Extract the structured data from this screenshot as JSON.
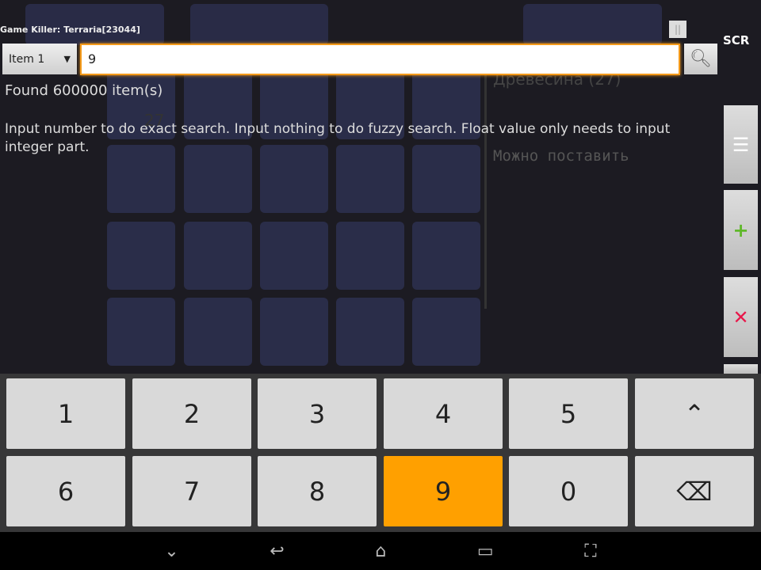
{
  "header": {
    "title": "Game Killer: Terraria[23044]",
    "pause_icon": "pause-icon",
    "scr_label": "SCR"
  },
  "search": {
    "item_select": "Item 1",
    "value": "9",
    "search_icon": "search-icon"
  },
  "status": {
    "found": "Found 600000 item(s)",
    "hint": "Input number to do exact search. Input nothing to do fuzzy search. Float value only needs to input integer part."
  },
  "game": {
    "item_name": "Древесина (27)",
    "item_desc": "Можно поставить",
    "stack_count": "27"
  },
  "side_buttons": [
    {
      "icon": "list-icon",
      "glyph": "☰",
      "color": "#ffffff"
    },
    {
      "icon": "plus-icon",
      "glyph": "+",
      "color": "#5fb82a"
    },
    {
      "icon": "close-icon",
      "glyph": "✕",
      "color": "#e8174a"
    }
  ],
  "keyboard": {
    "row1": [
      "1",
      "2",
      "3",
      "4",
      "5",
      "⌃"
    ],
    "row2": [
      "6",
      "7",
      "8",
      "9",
      "0",
      "⌫"
    ],
    "active_key": "9",
    "accent": "#ffa000"
  },
  "nav": [
    "⌄",
    "↩",
    "⌂",
    "▭",
    "⛶"
  ]
}
